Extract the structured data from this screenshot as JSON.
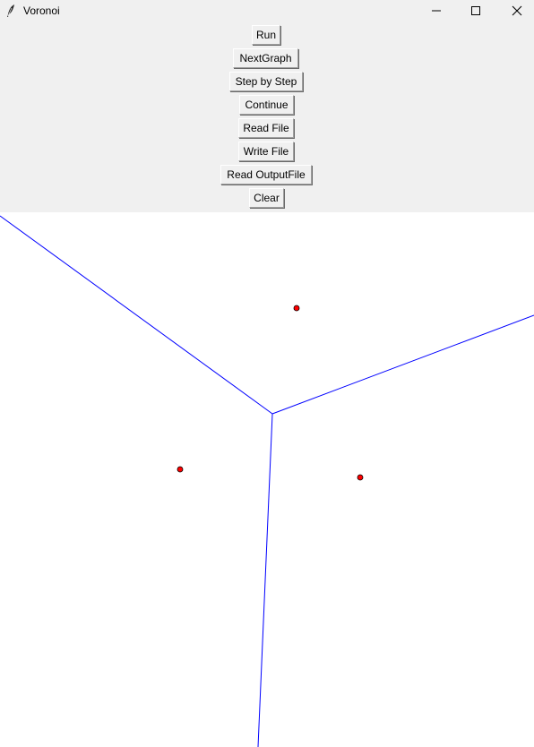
{
  "window": {
    "title": "Voronoi",
    "app_icon": "feather-icon",
    "controls": [
      "minimize-icon",
      "maximize-icon",
      "close-icon"
    ]
  },
  "toolbar": {
    "run_label": "Run",
    "next_graph_label": "NextGraph",
    "step_label": "Step by Step",
    "continue_label": "Continue",
    "read_file_label": "Read File",
    "write_file_label": "Write File",
    "read_output_label": "Read OutputFile",
    "clear_label": "Clear"
  },
  "canvas": {
    "background": "#ffffff",
    "site_color": "#ff0000",
    "edge_color": "#0000ff"
  }
}
